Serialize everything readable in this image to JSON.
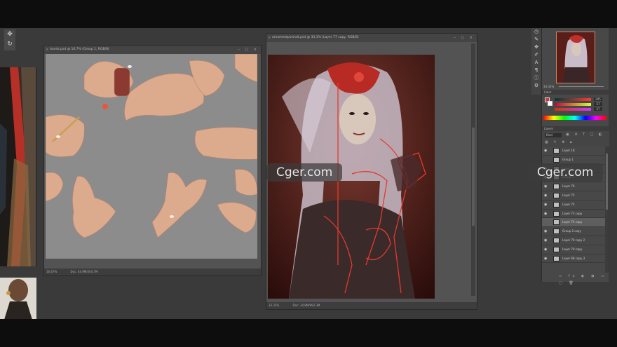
{
  "hands_doc": {
    "title": "hands.psd @ 16.7% (Group 1, RGB/8)",
    "zoom": "16.67%",
    "doc_size": "Doc: 44.9M/204.7M"
  },
  "portrait_doc": {
    "title": "ornamentportrait.psd @ 33.3% (Layer 77 copy, RGB/8)",
    "zoom": "33.33%",
    "doc_size": "Doc: 34.8M/992.3M"
  },
  "navigator": {
    "zoom": "33.33%"
  },
  "color_panel": {
    "title": "Color",
    "r": "205",
    "g": "57",
    "b": "57",
    "foreground": "#cd3a39",
    "background": "#ffffff"
  },
  "layers_panel": {
    "title": "Layers",
    "kind_filter": "Kind",
    "layers": [
      {
        "name": "Layer 18",
        "visible": true
      },
      {
        "name": "Group 1",
        "visible": false
      },
      {
        "name": "Layer 1",
        "visible": true
      },
      {
        "name": "Group 3",
        "visible": true
      },
      {
        "name": "Layer 76",
        "visible": true
      },
      {
        "name": "Layer 75",
        "visible": true
      },
      {
        "name": "Layer 74",
        "visible": true
      },
      {
        "name": "Layer 73 copy",
        "visible": true
      },
      {
        "name": "Layer 72 copy",
        "visible": false,
        "active": true
      },
      {
        "name": "Group 2 copy",
        "visible": true
      },
      {
        "name": "Layer 70 copy 2",
        "visible": true
      },
      {
        "name": "Layer 70 copy",
        "visible": true
      },
      {
        "name": "Layer 68 copy 3",
        "visible": true
      }
    ]
  },
  "watermarks": {
    "center": "Cger.com",
    "right": "Cger.com"
  },
  "colors": {
    "workspace": "#3a3a3a",
    "canvas_gray": "#8c8c8c",
    "accent_red": "#d8382e"
  }
}
